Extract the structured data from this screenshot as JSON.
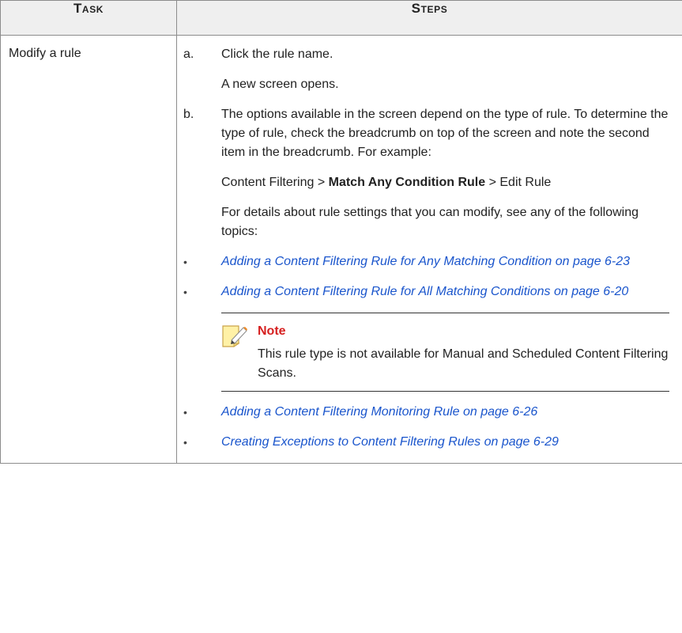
{
  "table": {
    "headers": {
      "task": "Task",
      "steps": "Steps"
    },
    "row": {
      "task": "Modify a rule",
      "step_a": {
        "letter": "a.",
        "text": "Click the rule name.",
        "follow": "A new screen opens."
      },
      "step_b": {
        "letter": "b.",
        "text": "The options available in the screen depend on the type of rule. To determine the type of rule, check the breadcrumb on top of the screen and note the second item in the breadcrumb. For example:",
        "breadcrumb_pre": "Content Filtering > ",
        "breadcrumb_bold": "Match Any Condition Rule",
        "breadcrumb_post": " > Edit Rule",
        "details": "For details about rule settings that you can modify, see any of the following topics:",
        "links": [
          "Adding a Content Filtering Rule for Any Matching Condition on page 6-23",
          "Adding a Content Filtering Rule for All Matching Conditions on page 6-20",
          "Adding a Content Filtering Monitoring Rule on page 6-26",
          "Creating Exceptions to Content Filtering Rules on page 6-29"
        ],
        "note": {
          "title": "Note",
          "text": "This rule type is not available for Manual and Scheduled Content Filtering Scans."
        }
      }
    }
  },
  "icons": {
    "note": "note-pencil-icon"
  },
  "colors": {
    "link": "#1a55cc",
    "note_title": "#d62020",
    "header_bg": "#efefef"
  }
}
